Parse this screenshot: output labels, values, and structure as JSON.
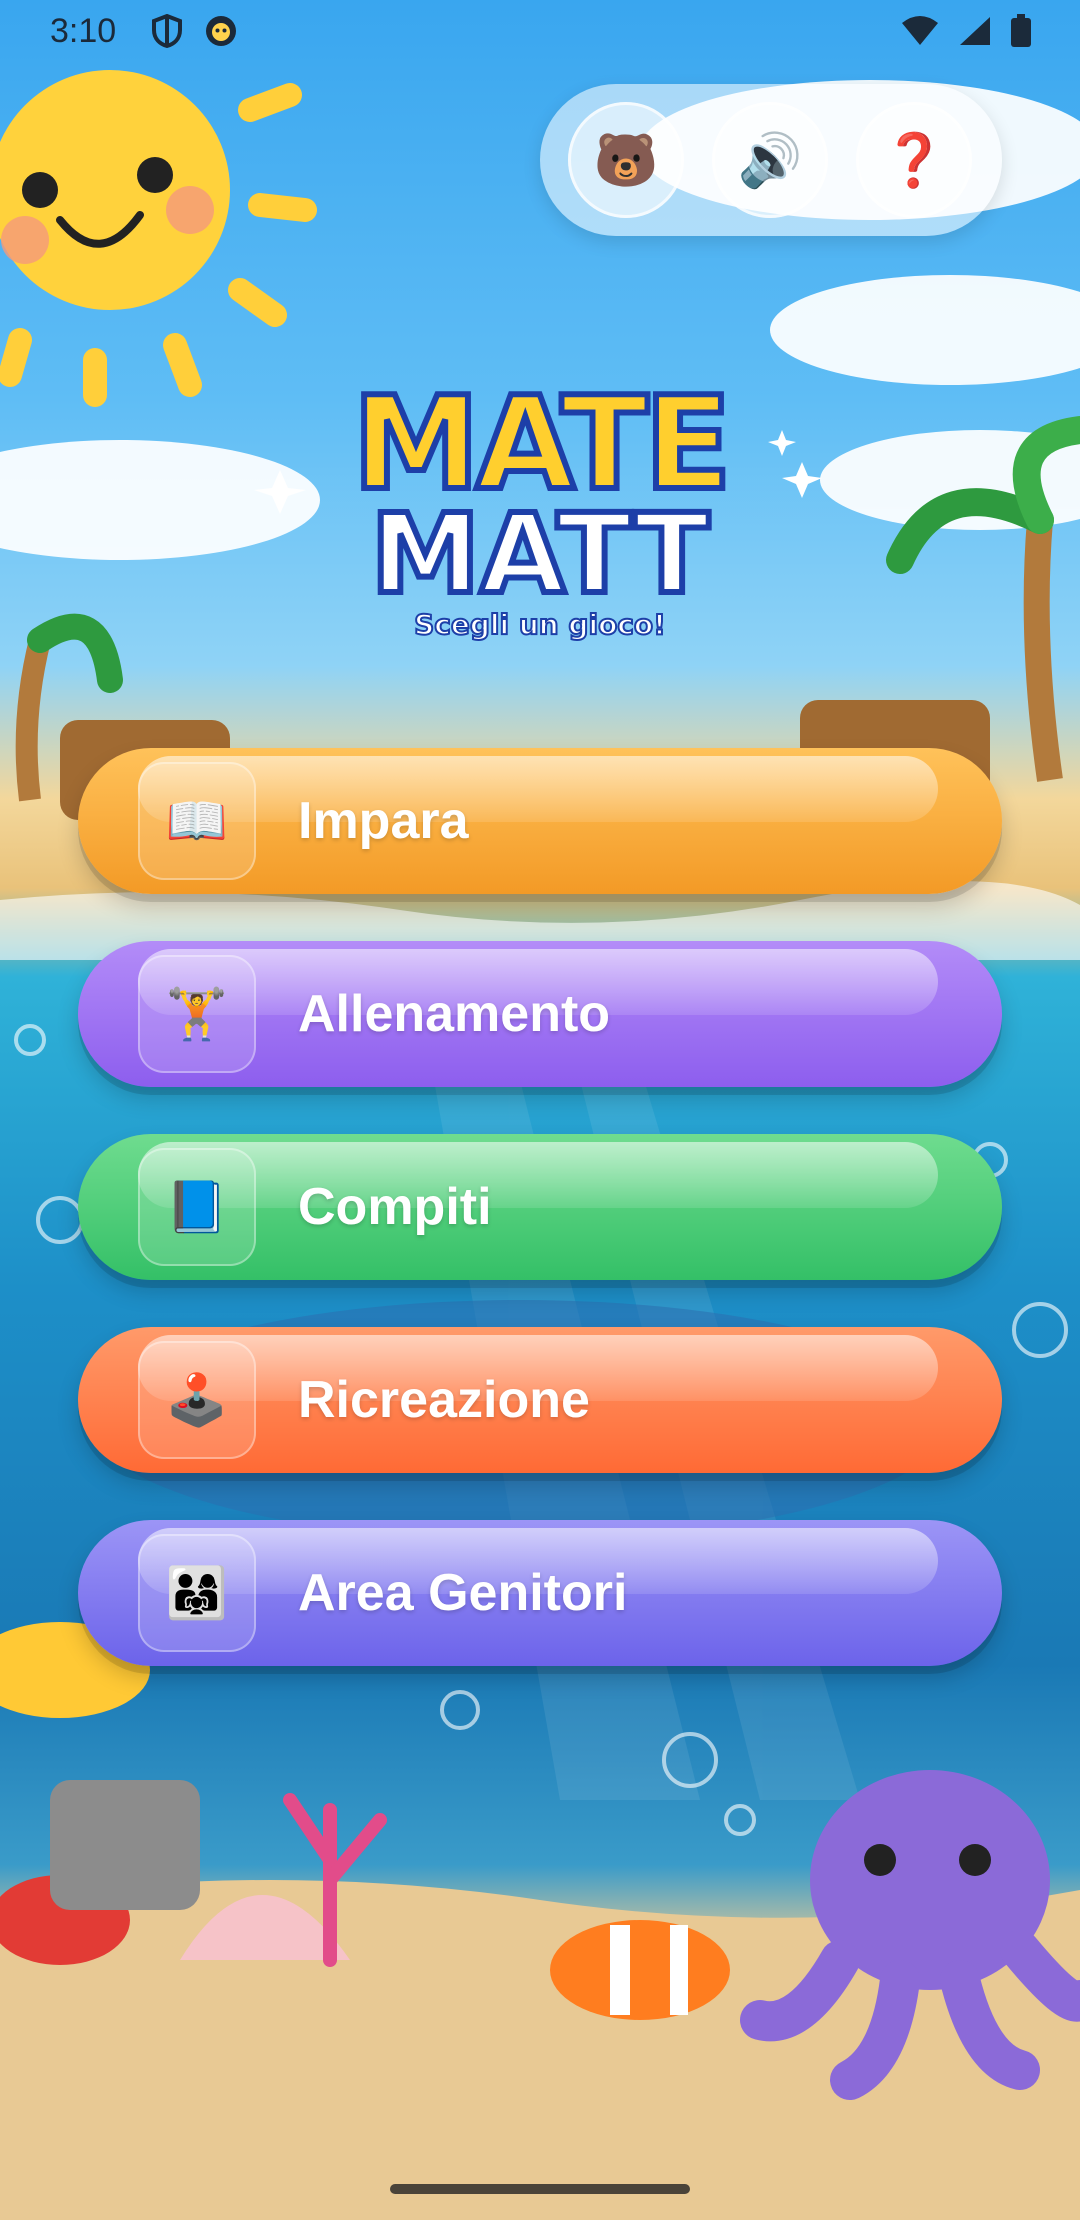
{
  "status_bar": {
    "time": "3:10",
    "left_icons": [
      "shield-icon",
      "avatar-notification-icon"
    ],
    "right_icons": [
      "wifi-icon",
      "signal-icon",
      "battery-icon"
    ]
  },
  "top_controls": {
    "buttons": [
      {
        "name": "bear-button",
        "icon": "🐻"
      },
      {
        "name": "sound-button",
        "icon": "🔊"
      },
      {
        "name": "help-button",
        "icon": "❓"
      }
    ]
  },
  "logo": {
    "line1": "MATE",
    "line2": "MATT",
    "subtitle": "Scegli un gioco!"
  },
  "menu": {
    "items": [
      {
        "label": "Impara",
        "icon": "📖",
        "color": "#f6a93b"
      },
      {
        "label": "Allenamento",
        "icon": "🏋️",
        "color": "#9b6cf2"
      },
      {
        "label": "Compiti",
        "icon": "📘",
        "color": "#43c975"
      },
      {
        "label": "Ricreazione",
        "icon": "🕹️",
        "color": "#ff7a4a"
      },
      {
        "label": "Area Genitori",
        "icon": "👨‍👩‍👧",
        "color": "#7c74f0"
      }
    ]
  }
}
